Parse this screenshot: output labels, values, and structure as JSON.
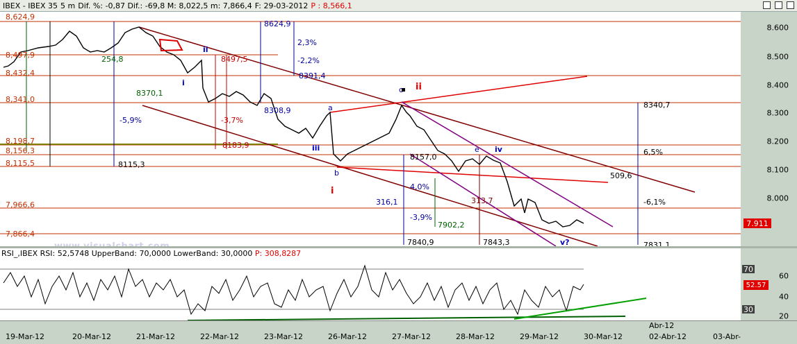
{
  "window": {
    "symbol": "IBEX - IBEX 35",
    "interval": "5 m",
    "stats": "Dif. %: -0,87 Dif.: -69,8 M: 8,022,5 m: 7,866,4",
    "date": "F: 29-03-2012",
    "price_label": "P : 8,566,1"
  },
  "price_axis": {
    "labels": [
      "8.600",
      "8.500",
      "8.400",
      "8.300",
      "8.200",
      "8.100",
      "8.000",
      "7.900"
    ],
    "current": "7.911"
  },
  "left_levels": [
    "8,624,9",
    "8,497,9",
    "8,432,4",
    "8,341,0",
    "8,198,7",
    "8,156,3",
    "8,115,5",
    "7,966,6",
    "7,866,4"
  ],
  "annotations": {
    "wave_i_top": "i",
    "wave_ii_top": "ii",
    "wave_ii": "ii",
    "wave_iii": "iii",
    "wave_i": "i",
    "wave_iv": "iv",
    "wave_v": "v?",
    "a": "a",
    "b": "b",
    "c": "c",
    "e": "e",
    "v8624": "8624,9",
    "v8497": "8497,5",
    "v8340": "8340,7",
    "v8308": "8308,9",
    "v8183": "8183,9",
    "v8157": "8157,0",
    "v7902": "7902,2",
    "v7840": "7840,9",
    "v7843": "7843,3",
    "v7831": "7831,1",
    "v8115": "8115,3",
    "v8370": "8370,1",
    "v8391": "8391,4",
    "p65": "6,5%",
    "p61": "-6,1%",
    "p40": "4,0%",
    "p39": "-3,9%",
    "p37": "-3,7%",
    "p59": "-5,9%",
    "p23": "2,3%",
    "p22": "-2,2%",
    "r509": "509,6",
    "r316": "316,1",
    "r313": "313,7",
    "r254": "254,8"
  },
  "watermark": "www.visualchart.com",
  "rsi": {
    "label": "RSI_,IBEX RSI:",
    "value_text": "52,5748",
    "upper": "UpperBand: 70,0000",
    "lower": "LowerBand: 30,0000",
    "p_label": "P: 308,8287",
    "axis_labels": [
      "70",
      "60",
      "50",
      "40",
      "30",
      "20"
    ],
    "current": "52.57",
    "tag70": "70",
    "tag30": "30"
  },
  "x_axis": [
    "19-Mar-12",
    "20-Mar-12",
    "21-Mar-12",
    "22-Mar-12",
    "23-Mar-12",
    "26-Mar-12",
    "27-Mar-12",
    "28-Mar-12",
    "29-Mar-12",
    "30-Mar-12",
    "02-Abr-12",
    "03-Abr-"
  ],
  "x_month": "Abr-12",
  "colors": {
    "price": "#000000",
    "fib": "#c03000",
    "channel": "#800000",
    "wave": "#e00000",
    "blue": "#0000a0",
    "purple": "#800080",
    "green": "#00a000"
  }
}
